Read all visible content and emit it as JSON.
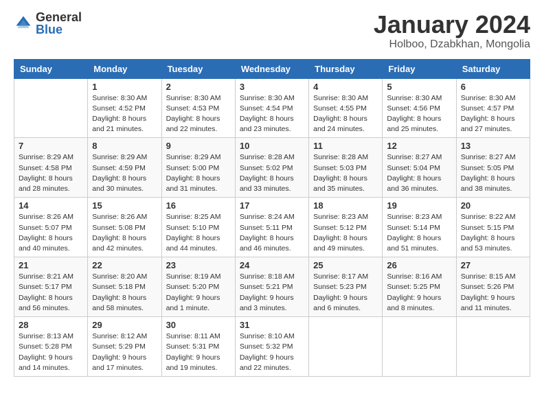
{
  "header": {
    "logo_general": "General",
    "logo_blue": "Blue",
    "month_title": "January 2024",
    "subtitle": "Holboo, Dzabkhan, Mongolia"
  },
  "calendar": {
    "days_of_week": [
      "Sunday",
      "Monday",
      "Tuesday",
      "Wednesday",
      "Thursday",
      "Friday",
      "Saturday"
    ],
    "weeks": [
      [
        {
          "day": "",
          "info": ""
        },
        {
          "day": "1",
          "info": "Sunrise: 8:30 AM\nSunset: 4:52 PM\nDaylight: 8 hours\nand 21 minutes."
        },
        {
          "day": "2",
          "info": "Sunrise: 8:30 AM\nSunset: 4:53 PM\nDaylight: 8 hours\nand 22 minutes."
        },
        {
          "day": "3",
          "info": "Sunrise: 8:30 AM\nSunset: 4:54 PM\nDaylight: 8 hours\nand 23 minutes."
        },
        {
          "day": "4",
          "info": "Sunrise: 8:30 AM\nSunset: 4:55 PM\nDaylight: 8 hours\nand 24 minutes."
        },
        {
          "day": "5",
          "info": "Sunrise: 8:30 AM\nSunset: 4:56 PM\nDaylight: 8 hours\nand 25 minutes."
        },
        {
          "day": "6",
          "info": "Sunrise: 8:30 AM\nSunset: 4:57 PM\nDaylight: 8 hours\nand 27 minutes."
        }
      ],
      [
        {
          "day": "7",
          "info": "Sunrise: 8:29 AM\nSunset: 4:58 PM\nDaylight: 8 hours\nand 28 minutes."
        },
        {
          "day": "8",
          "info": "Sunrise: 8:29 AM\nSunset: 4:59 PM\nDaylight: 8 hours\nand 30 minutes."
        },
        {
          "day": "9",
          "info": "Sunrise: 8:29 AM\nSunset: 5:00 PM\nDaylight: 8 hours\nand 31 minutes."
        },
        {
          "day": "10",
          "info": "Sunrise: 8:28 AM\nSunset: 5:02 PM\nDaylight: 8 hours\nand 33 minutes."
        },
        {
          "day": "11",
          "info": "Sunrise: 8:28 AM\nSunset: 5:03 PM\nDaylight: 8 hours\nand 35 minutes."
        },
        {
          "day": "12",
          "info": "Sunrise: 8:27 AM\nSunset: 5:04 PM\nDaylight: 8 hours\nand 36 minutes."
        },
        {
          "day": "13",
          "info": "Sunrise: 8:27 AM\nSunset: 5:05 PM\nDaylight: 8 hours\nand 38 minutes."
        }
      ],
      [
        {
          "day": "14",
          "info": "Sunrise: 8:26 AM\nSunset: 5:07 PM\nDaylight: 8 hours\nand 40 minutes."
        },
        {
          "day": "15",
          "info": "Sunrise: 8:26 AM\nSunset: 5:08 PM\nDaylight: 8 hours\nand 42 minutes."
        },
        {
          "day": "16",
          "info": "Sunrise: 8:25 AM\nSunset: 5:10 PM\nDaylight: 8 hours\nand 44 minutes."
        },
        {
          "day": "17",
          "info": "Sunrise: 8:24 AM\nSunset: 5:11 PM\nDaylight: 8 hours\nand 46 minutes."
        },
        {
          "day": "18",
          "info": "Sunrise: 8:23 AM\nSunset: 5:12 PM\nDaylight: 8 hours\nand 49 minutes."
        },
        {
          "day": "19",
          "info": "Sunrise: 8:23 AM\nSunset: 5:14 PM\nDaylight: 8 hours\nand 51 minutes."
        },
        {
          "day": "20",
          "info": "Sunrise: 8:22 AM\nSunset: 5:15 PM\nDaylight: 8 hours\nand 53 minutes."
        }
      ],
      [
        {
          "day": "21",
          "info": "Sunrise: 8:21 AM\nSunset: 5:17 PM\nDaylight: 8 hours\nand 56 minutes."
        },
        {
          "day": "22",
          "info": "Sunrise: 8:20 AM\nSunset: 5:18 PM\nDaylight: 8 hours\nand 58 minutes."
        },
        {
          "day": "23",
          "info": "Sunrise: 8:19 AM\nSunset: 5:20 PM\nDaylight: 9 hours\nand 1 minute."
        },
        {
          "day": "24",
          "info": "Sunrise: 8:18 AM\nSunset: 5:21 PM\nDaylight: 9 hours\nand 3 minutes."
        },
        {
          "day": "25",
          "info": "Sunrise: 8:17 AM\nSunset: 5:23 PM\nDaylight: 9 hours\nand 6 minutes."
        },
        {
          "day": "26",
          "info": "Sunrise: 8:16 AM\nSunset: 5:25 PM\nDaylight: 9 hours\nand 8 minutes."
        },
        {
          "day": "27",
          "info": "Sunrise: 8:15 AM\nSunset: 5:26 PM\nDaylight: 9 hours\nand 11 minutes."
        }
      ],
      [
        {
          "day": "28",
          "info": "Sunrise: 8:13 AM\nSunset: 5:28 PM\nDaylight: 9 hours\nand 14 minutes."
        },
        {
          "day": "29",
          "info": "Sunrise: 8:12 AM\nSunset: 5:29 PM\nDaylight: 9 hours\nand 17 minutes."
        },
        {
          "day": "30",
          "info": "Sunrise: 8:11 AM\nSunset: 5:31 PM\nDaylight: 9 hours\nand 19 minutes."
        },
        {
          "day": "31",
          "info": "Sunrise: 8:10 AM\nSunset: 5:32 PM\nDaylight: 9 hours\nand 22 minutes."
        },
        {
          "day": "",
          "info": ""
        },
        {
          "day": "",
          "info": ""
        },
        {
          "day": "",
          "info": ""
        }
      ]
    ]
  }
}
